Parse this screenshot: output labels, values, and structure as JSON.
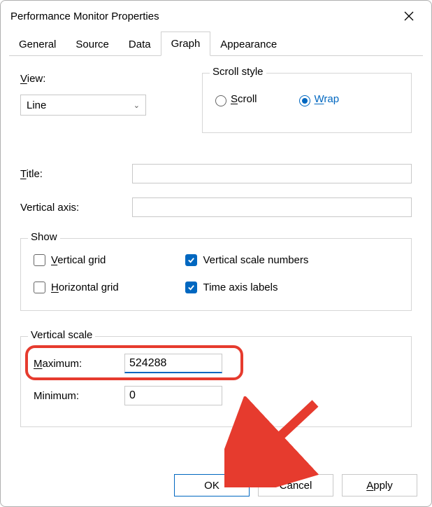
{
  "title": "Performance Monitor Properties",
  "tabs": [
    "General",
    "Source",
    "Data",
    "Graph",
    "Appearance"
  ],
  "active_tab": "Graph",
  "view": {
    "label": "View:",
    "selected": "Line"
  },
  "scroll_style": {
    "legend": "Scroll style",
    "options": {
      "scroll": "Scroll",
      "wrap": "Wrap"
    },
    "selected": "wrap"
  },
  "title_field": {
    "label": "Title:",
    "value": ""
  },
  "vaxis_field": {
    "label": "Vertical axis:",
    "value": ""
  },
  "show": {
    "legend": "Show",
    "vertical_grid": {
      "label": "Vertical grid",
      "checked": false
    },
    "horizontal_grid": {
      "label": "Horizontal grid",
      "checked": false
    },
    "vscale_numbers": {
      "label": "Vertical scale numbers",
      "checked": true
    },
    "time_axis_labels": {
      "label": "Time axis labels",
      "checked": true
    }
  },
  "vertical_scale": {
    "legend": "Vertical scale",
    "maximum": {
      "label": "Maximum:",
      "value": "524288"
    },
    "minimum": {
      "label": "Minimum:",
      "value": "0"
    }
  },
  "buttons": {
    "ok": "OK",
    "cancel": "Cancel",
    "apply": "Apply"
  },
  "annotations": {
    "highlight_target": "maximum-row",
    "arrow_target": "ok-button"
  }
}
